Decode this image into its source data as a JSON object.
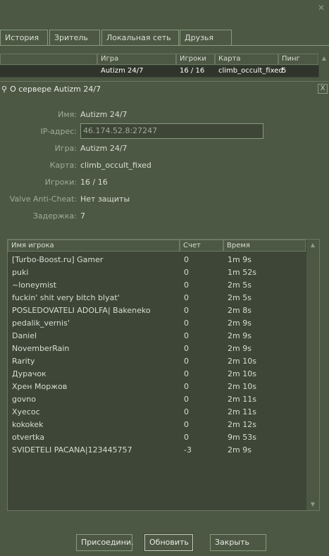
{
  "tabs": [
    "История",
    "Зритель",
    "Локальная сеть",
    "Друзья"
  ],
  "server_list": {
    "headers": [
      "Игра",
      "Игроки",
      "Карта",
      "Пинг"
    ],
    "row": {
      "game": "Autizm 24/7",
      "players": "16 / 16",
      "map": "climb_occult_fixed",
      "ping": "5"
    }
  },
  "panel": {
    "title": "О сервере Autizm 24/7",
    "close": "X"
  },
  "info": {
    "name_label": "Имя:",
    "name": "Autizm 24/7",
    "ip_label": "IP-адрес:",
    "ip": "46.174.52.8:27247",
    "game_label": "Игра:",
    "game": "Autizm 24/7",
    "map_label": "Карта:",
    "map": "climb_occult_fixed",
    "players_label": "Игроки:",
    "players": "16 / 16",
    "vac_label": "Valve Anti-Cheat:",
    "vac": "Нет защиты",
    "latency_label": "Задержка:",
    "latency": "7"
  },
  "players": {
    "headers": [
      "Имя игрока",
      "Счет",
      "Время"
    ],
    "rows": [
      [
        "[Turbo-Boost.ru] Gamer",
        "0",
        "1m 9s"
      ],
      [
        "puki",
        "0",
        "1m 52s"
      ],
      [
        "~loneymist",
        "0",
        "2m 5s"
      ],
      [
        "fuckin' shit very bitch blyat'",
        "0",
        "2m 5s"
      ],
      [
        "POSLEDOVATELI ADOLFA| Bakeneko",
        "0",
        "2m 8s"
      ],
      [
        "pedalik_vernis'",
        "0",
        "2m 9s"
      ],
      [
        "Daniel",
        "0",
        "2m 9s"
      ],
      [
        "NovemberRain",
        "0",
        "2m 9s"
      ],
      [
        "Rarity",
        "0",
        "2m 10s"
      ],
      [
        "Дурачок",
        "0",
        "2m 10s"
      ],
      [
        "Хрен Моржов",
        "0",
        "2m 10s"
      ],
      [
        "govno",
        "0",
        "2m 11s"
      ],
      [
        "Xyecoc",
        "0",
        "2m 11s"
      ],
      [
        "kokokek",
        "0",
        "2m 12s"
      ],
      [
        "otvertka",
        "0",
        "9m 53s"
      ],
      [
        "SVIDETELI PACANA|123445757",
        "-3",
        "2m 9s"
      ]
    ]
  },
  "buttons": {
    "join": "Присоедини.",
    "refresh": "Обновить",
    "close": "Закрыть"
  },
  "icons": {
    "close_top": "close-icon",
    "pin": "pin-icon",
    "scroll_up": "arrow-up-icon",
    "scroll_down": "arrow-down-icon"
  }
}
